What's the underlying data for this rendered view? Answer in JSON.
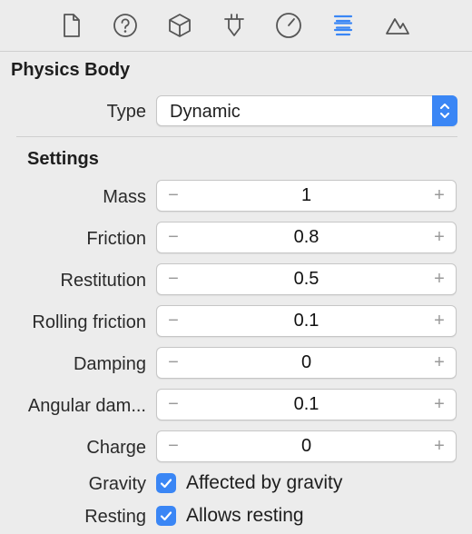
{
  "toolbar": {
    "icons": [
      "file-icon",
      "help-icon",
      "cube-icon",
      "component-icon",
      "clock-icon",
      "physics-icon",
      "mountain-icon"
    ],
    "selected": "physics-icon",
    "accent": "#3a86f5"
  },
  "physics": {
    "title": "Physics Body",
    "type_label": "Type",
    "type_value": "Dynamic"
  },
  "settings": {
    "title": "Settings",
    "minus_glyph": "−",
    "plus_glyph": "+",
    "rows": [
      {
        "label": "Mass",
        "value": "1"
      },
      {
        "label": "Friction",
        "value": "0.8"
      },
      {
        "label": "Restitution",
        "value": "0.5"
      },
      {
        "label": "Rolling friction",
        "value": "0.1"
      },
      {
        "label": "Damping",
        "value": "0"
      },
      {
        "label": "Angular dam...",
        "value": "0.1"
      },
      {
        "label": "Charge",
        "value": "0"
      }
    ]
  },
  "gravity": {
    "label": "Gravity",
    "checkbox_label": "Affected by gravity",
    "checked": true
  },
  "resting": {
    "label": "Resting",
    "checkbox_label": "Allows resting",
    "checked": true
  }
}
